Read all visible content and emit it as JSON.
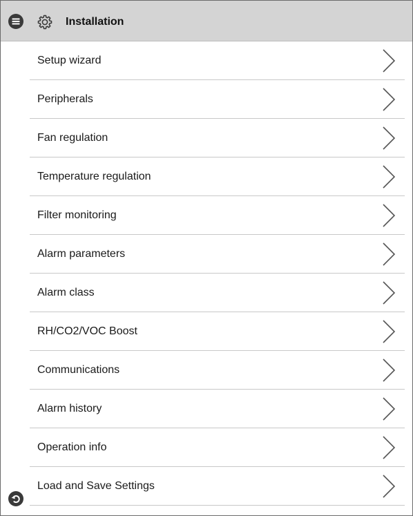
{
  "header": {
    "title": "Installation",
    "menu_icon": "menu-icon",
    "gear_icon": "gear-icon"
  },
  "menu": {
    "items": [
      {
        "label": "Setup wizard"
      },
      {
        "label": "Peripherals"
      },
      {
        "label": "Fan regulation"
      },
      {
        "label": "Temperature regulation"
      },
      {
        "label": "Filter monitoring"
      },
      {
        "label": "Alarm parameters"
      },
      {
        "label": "Alarm class"
      },
      {
        "label": "RH/CO2/VOC Boost"
      },
      {
        "label": "Communications"
      },
      {
        "label": "Alarm history"
      },
      {
        "label": "Operation info"
      },
      {
        "label": "Load and Save Settings"
      }
    ],
    "chevron_icon": "chevron-right-icon"
  },
  "footer": {
    "back_icon": "back-icon"
  },
  "colors": {
    "header_bg": "#d4d4d4",
    "divider": "#c8c8c8",
    "icon_dark": "#3a3a3a",
    "chevron": "#555555"
  }
}
